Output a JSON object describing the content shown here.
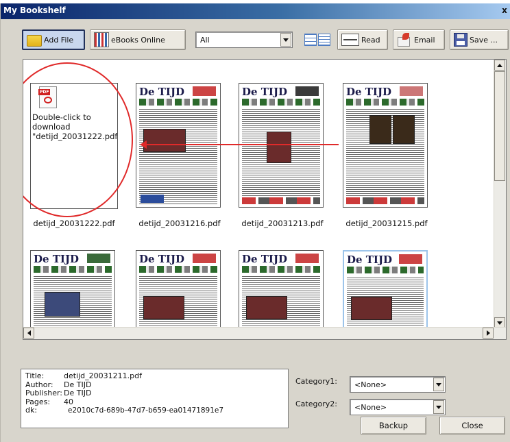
{
  "window": {
    "title": "My Bookshelf",
    "close_glyph": "x"
  },
  "toolbar": {
    "add_file": "Add File",
    "ebooks_online": "eBooks Online",
    "filter_value": "All",
    "read": "Read",
    "email": "Email",
    "save": "Save ..."
  },
  "books": [
    {
      "caption": "detijd_20031222.pdf",
      "placeholder_text": "Double-click to download \"detijd_20031222.pdf\"",
      "pdf_tag": "PDF"
    },
    {
      "caption": "detijd_20031216.pdf",
      "masthead": "De TIJD"
    },
    {
      "caption": "detijd_20031213.pdf",
      "masthead": "De TIJD"
    },
    {
      "caption": "detijd_20031215.pdf",
      "masthead": "De TIJD"
    },
    {
      "masthead": "De TIJD"
    },
    {
      "masthead": "De TIJD"
    },
    {
      "masthead": "De TIJD"
    },
    {
      "masthead": "De TIJD"
    }
  ],
  "details": {
    "title_label": "Title:",
    "title_value": "detijd_20031211.pdf",
    "author_label": "Author:",
    "author_value": "De TIJD",
    "publisher_label": "Publisher:",
    "publisher_value": "De TIJD",
    "pages_label": "Pages:",
    "pages_value": "40",
    "dk_label": "dk:",
    "dk_value": "e2010c7d-689b-47d7-b659-ea01471891e7"
  },
  "categories": {
    "cat1_label": "Category1:",
    "cat1_value": "<None>",
    "cat2_label": "Category2:",
    "cat2_value": "<None>"
  },
  "buttons": {
    "backup": "Backup",
    "close": "Close"
  },
  "annotation_color": "#e02a2a",
  "title_gradient": [
    "#0a246a",
    "#a6caf0"
  ]
}
